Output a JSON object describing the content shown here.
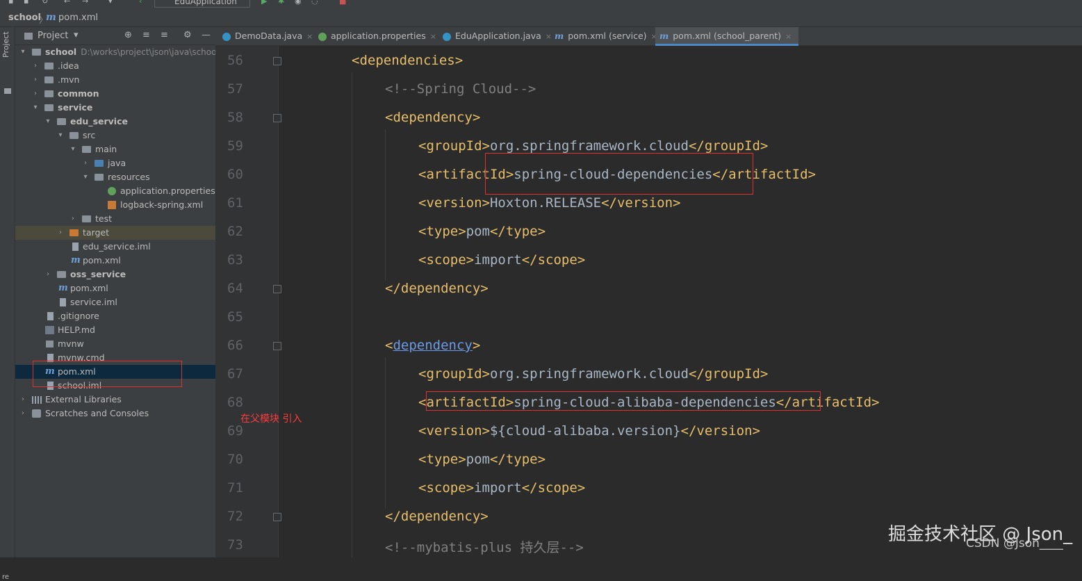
{
  "toolbar": {
    "run_config": "EduApplication"
  },
  "nav": {
    "project": "school",
    "file": "pom.xml"
  },
  "stripe": {
    "project_label": "Project",
    "bottom_label": "re"
  },
  "panel": {
    "title": "Project"
  },
  "tree": {
    "root_name": "school",
    "root_path": "D:\\works\\project\\json\\java\\school",
    "idea": ".idea",
    "mvn": ".mvn",
    "common": "common",
    "service": "service",
    "edu_service": "edu_service",
    "src": "src",
    "main": "main",
    "java": "java",
    "resources": "resources",
    "app_props": "application.properties",
    "logback": "logback-spring.xml",
    "test": "test",
    "target": "target",
    "edu_iml": "edu_service.iml",
    "edu_pom": "pom.xml",
    "oss_service": "oss_service",
    "service_pom": "pom.xml",
    "service_iml": "service.iml",
    "gitignore": ".gitignore",
    "help": "HELP.md",
    "mvnw": "mvnw",
    "mvnw_cmd": "mvnw.cmd",
    "root_pom": "pom.xml",
    "school_iml": "school.iml",
    "ext_libs": "External Libraries",
    "scratches": "Scratches and Consoles"
  },
  "tabs": [
    {
      "label": "DemoData.java"
    },
    {
      "label": "application.properties"
    },
    {
      "label": "EduApplication.java"
    },
    {
      "label": "pom.xml (service)"
    },
    {
      "label": "pom.xml (school_parent)"
    }
  ],
  "tab_close": "×",
  "editor": {
    "line_numbers": [
      "56",
      "57",
      "58",
      "59",
      "60",
      "61",
      "62",
      "63",
      "64",
      "65",
      "66",
      "67",
      "68",
      "69",
      "70",
      "71",
      "72",
      "73"
    ],
    "l56": "<dependencies>",
    "l57": "<!--Spring Cloud-->",
    "l58": "<dependency>",
    "l59": {
      "open": "<groupId>",
      "val": "org.springframework.cloud",
      "close": "</groupId>"
    },
    "l60": {
      "open": "<artifactId>",
      "val": "spring-cloud-dependencies",
      "close": "</artifactId>"
    },
    "l61": {
      "open": "<version>",
      "val": "Hoxton.RELEASE",
      "close": "</version>"
    },
    "l62": {
      "open": "<type>",
      "val": "pom",
      "close": "</type>"
    },
    "l63": {
      "open": "<scope>",
      "val": "import",
      "close": "</scope>"
    },
    "l64": "</dependency>",
    "l66": {
      "lt": "<",
      "name": "dependency",
      "gt": ">"
    },
    "l67": {
      "open": "<groupId>",
      "val": "org.springframework.cloud",
      "close": "</groupId>"
    },
    "l68": {
      "open": "<artifactId>",
      "val": "spring-cloud-alibaba-dependencies",
      "close": "</artifactId>"
    },
    "l69": {
      "open": "<version>",
      "val": "${cloud-alibaba.version}",
      "close": "</version>"
    },
    "l70": {
      "open": "<type>",
      "val": "pom",
      "close": "</type>"
    },
    "l71": {
      "open": "<scope>",
      "val": "import",
      "close": "</scope>"
    },
    "l72": "</dependency>",
    "l73": "<!--mybatis-plus 持久层-->"
  },
  "annotation": "在父模块 引入",
  "watermark": {
    "main": "掘金技术社区 @ Json_",
    "csdn": "CSDN @Json____"
  },
  "colors": {
    "tag": "#e8bf6a",
    "comment": "#808080",
    "text": "#a9b7c6",
    "highlight_box": "#e03131",
    "selected_row": "#0d293e"
  }
}
